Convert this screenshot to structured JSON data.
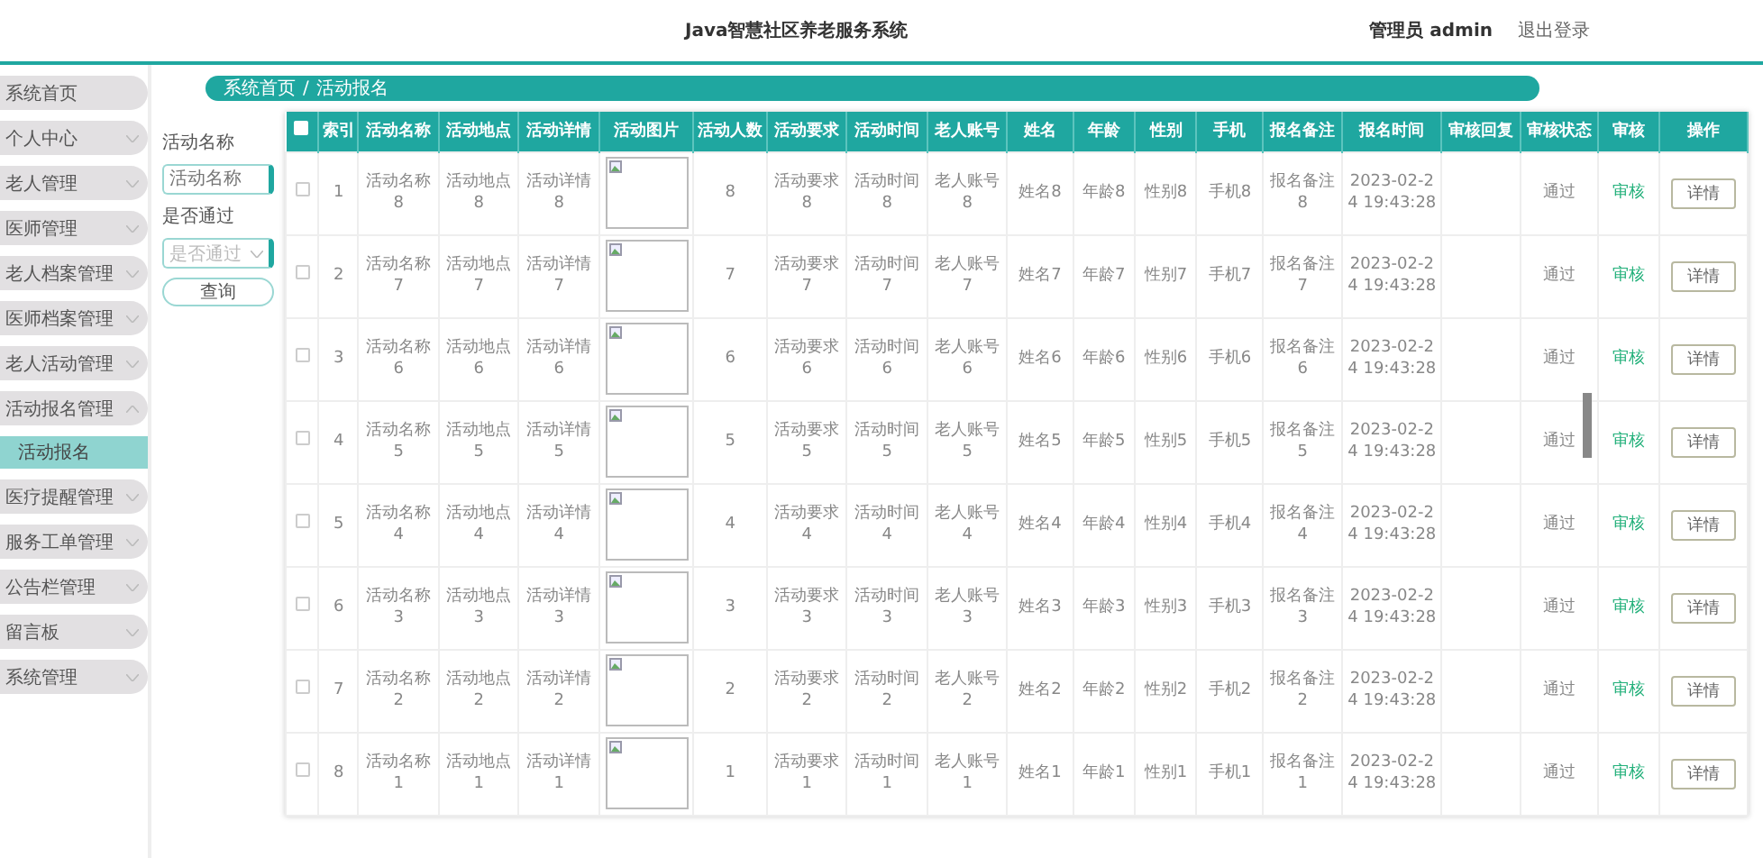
{
  "header": {
    "title": "Java智慧社区养老服务系统",
    "user": "管理员 admin",
    "logout": "退出登录"
  },
  "sidebar": {
    "items": [
      {
        "label": "系统首页",
        "kind": "link"
      },
      {
        "label": "个人中心",
        "kind": "menu",
        "expanded": false
      },
      {
        "label": "老人管理",
        "kind": "menu",
        "expanded": false
      },
      {
        "label": "医师管理",
        "kind": "menu",
        "expanded": false
      },
      {
        "label": "老人档案管理",
        "kind": "menu",
        "expanded": false
      },
      {
        "label": "医师档案管理",
        "kind": "menu",
        "expanded": false
      },
      {
        "label": "老人活动管理",
        "kind": "menu",
        "expanded": false
      },
      {
        "label": "活动报名管理",
        "kind": "menu",
        "expanded": true,
        "children": [
          {
            "label": "活动报名",
            "selected": true
          }
        ]
      },
      {
        "label": "医疗提醒管理",
        "kind": "menu",
        "expanded": false
      },
      {
        "label": "服务工单管理",
        "kind": "menu",
        "expanded": false
      },
      {
        "label": "公告栏管理",
        "kind": "menu",
        "expanded": false
      },
      {
        "label": "留言板",
        "kind": "menu",
        "expanded": false
      },
      {
        "label": "系统管理",
        "kind": "menu",
        "expanded": false
      }
    ]
  },
  "breadcrumb": {
    "items": [
      "系统首页",
      "活动报名"
    ],
    "separator": "/"
  },
  "filters": {
    "fields": [
      {
        "label": "活动名称",
        "kind": "input",
        "placeholder": "活动名称"
      },
      {
        "label": "是否通过",
        "kind": "select",
        "placeholder": "是否通过"
      }
    ],
    "search_button": "查询"
  },
  "table": {
    "header_checkbox": {
      "checked": false
    },
    "columns": [
      "索引",
      "活动名称",
      "活动地点",
      "活动详情",
      "活动图片",
      "活动人数",
      "活动要求",
      "活动时间",
      "老人账号",
      "姓名",
      "年龄",
      "性别",
      "手机",
      "报名备注",
      "报名时间",
      "审核回复",
      "审核状态",
      "审核",
      "操作"
    ],
    "rows": [
      {
        "selected": false,
        "index": "1",
        "name": "活动名称8",
        "place": "活动地点8",
        "detail": "活动详情8",
        "count": "8",
        "requirement": "活动要求8",
        "time": "活动时间8",
        "account": "老人账号8",
        "person": "姓名8",
        "age": "年龄8",
        "gender": "性别8",
        "phone": "手机8",
        "remark": "报名备注8",
        "signup_time": "2023-02-24 19:43:28",
        "status": "通过",
        "review": "审核",
        "action": "详情"
      },
      {
        "selected": false,
        "index": "2",
        "name": "活动名称7",
        "place": "活动地点7",
        "detail": "活动详情7",
        "count": "7",
        "requirement": "活动要求7",
        "time": "活动时间7",
        "account": "老人账号7",
        "person": "姓名7",
        "age": "年龄7",
        "gender": "性别7",
        "phone": "手机7",
        "remark": "报名备注7",
        "signup_time": "2023-02-24 19:43:28",
        "status": "通过",
        "review": "审核",
        "action": "详情"
      },
      {
        "selected": false,
        "index": "3",
        "name": "活动名称6",
        "place": "活动地点6",
        "detail": "活动详情6",
        "count": "6",
        "requirement": "活动要求6",
        "time": "活动时间6",
        "account": "老人账号6",
        "person": "姓名6",
        "age": "年龄6",
        "gender": "性别6",
        "phone": "手机6",
        "remark": "报名备注6",
        "signup_time": "2023-02-24 19:43:28",
        "status": "通过",
        "review": "审核",
        "action": "详情"
      },
      {
        "selected": false,
        "index": "4",
        "name": "活动名称5",
        "place": "活动地点5",
        "detail": "活动详情5",
        "count": "5",
        "requirement": "活动要求5",
        "time": "活动时间5",
        "account": "老人账号5",
        "person": "姓名5",
        "age": "年龄5",
        "gender": "性别5",
        "phone": "手机5",
        "remark": "报名备注5",
        "signup_time": "2023-02-24 19:43:28",
        "status": "通过",
        "review": "审核",
        "action": "详情"
      },
      {
        "selected": false,
        "index": "5",
        "name": "活动名称4",
        "place": "活动地点4",
        "detail": "活动详情4",
        "count": "4",
        "requirement": "活动要求4",
        "time": "活动时间4",
        "account": "老人账号4",
        "person": "姓名4",
        "age": "年龄4",
        "gender": "性别4",
        "phone": "手机4",
        "remark": "报名备注4",
        "signup_time": "2023-02-24 19:43:28",
        "status": "通过",
        "review": "审核",
        "action": "详情"
      },
      {
        "selected": false,
        "index": "6",
        "name": "活动名称3",
        "place": "活动地点3",
        "detail": "活动详情3",
        "count": "3",
        "requirement": "活动要求3",
        "time": "活动时间3",
        "account": "老人账号3",
        "person": "姓名3",
        "age": "年龄3",
        "gender": "性别3",
        "phone": "手机3",
        "remark": "报名备注3",
        "signup_time": "2023-02-24 19:43:28",
        "status": "通过",
        "review": "审核",
        "action": "详情"
      },
      {
        "selected": false,
        "index": "7",
        "name": "活动名称2",
        "place": "活动地点2",
        "detail": "活动详情2",
        "count": "2",
        "requirement": "活动要求2",
        "time": "活动时间2",
        "account": "老人账号2",
        "person": "姓名2",
        "age": "年龄2",
        "gender": "性别2",
        "phone": "手机2",
        "remark": "报名备注2",
        "signup_time": "2023-02-24 19:43:28",
        "status": "通过",
        "review": "审核",
        "action": "详情"
      },
      {
        "selected": false,
        "index": "8",
        "name": "活动名称1",
        "place": "活动地点1",
        "detail": "活动详情1",
        "count": "1",
        "requirement": "活动要求1",
        "time": "活动时间1",
        "account": "老人账号1",
        "person": "姓名1",
        "age": "年龄1",
        "gender": "性别1",
        "phone": "手机1",
        "remark": "报名备注1",
        "signup_time": "2023-02-24 19:43:28",
        "status": "通过",
        "review": "审核",
        "action": "详情"
      }
    ]
  }
}
